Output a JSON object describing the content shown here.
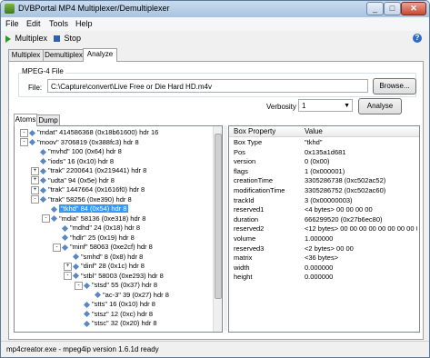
{
  "window": {
    "title": "DVBPortal MP4 Multiplexer/Demultiplexer"
  },
  "menu": [
    "File",
    "Edit",
    "Tools",
    "Help"
  ],
  "toolbar": {
    "multiplex": "Multiplex",
    "stop": "Stop",
    "help_icon": "help-icon"
  },
  "tabs": [
    "Multiplex",
    "Demultiplex",
    "Analyze"
  ],
  "file_group": {
    "title": "MPEG-4 File",
    "file_label": "File:",
    "path": "C:\\Capture\\convert\\Live Free or Die Hard HD.m4v",
    "browse": "Browse..."
  },
  "verbosity": {
    "label": "Verbosity",
    "value": "1",
    "analyse": "Analyse"
  },
  "subtabs": [
    "Atoms",
    "Dump"
  ],
  "tree": [
    {
      "text": "\"mdat\" 414586368 (0x18b61600) hdr 16",
      "expander": "-",
      "indent": 0
    },
    {
      "text": "\"moov\" 3706819 (0x388fc3) hdr 8",
      "expander": "-",
      "indent": 0
    },
    {
      "text": "\"mvhd\" 100 (0x64) hdr 8",
      "expander": "",
      "indent": 1
    },
    {
      "text": "\"iods\" 16 (0x10) hdr 8",
      "expander": "",
      "indent": 1
    },
    {
      "text": "\"trak\" 2200641 (0x219441) hdr 8",
      "expander": "+",
      "indent": 1
    },
    {
      "text": "\"udta\" 94 (0x5e) hdr 8",
      "expander": "+",
      "indent": 1
    },
    {
      "text": "\"trak\" 1447664 (0x1616f0) hdr 8",
      "expander": "+",
      "indent": 1
    },
    {
      "text": "\"trak\" 58256 (0xe390) hdr 8",
      "expander": "-",
      "indent": 1
    },
    {
      "text": "\"tkhd\" 84 (0x54) hdr 8",
      "expander": "",
      "indent": 2,
      "selected": true
    },
    {
      "text": "\"mdia\" 58136 (0xe318) hdr 8",
      "expander": "-",
      "indent": 2
    },
    {
      "text": "\"mdhd\" 24 (0x18) hdr 8",
      "expander": "",
      "indent": 3
    },
    {
      "text": "\"hdlr\" 25 (0x19) hdr 8",
      "expander": "",
      "indent": 3
    },
    {
      "text": "\"minf\" 58063 (0xe2cf) hdr 8",
      "expander": "-",
      "indent": 3
    },
    {
      "text": "\"smhd\" 8 (0x8) hdr 8",
      "expander": "",
      "indent": 4
    },
    {
      "text": "\"dinf\" 28 (0x1c) hdr 8",
      "expander": "+",
      "indent": 4
    },
    {
      "text": "\"stbl\" 58003 (0xe293) hdr 8",
      "expander": "-",
      "indent": 4
    },
    {
      "text": "\"stsd\" 55 (0x37) hdr 8",
      "expander": "-",
      "indent": 5
    },
    {
      "text": "\"ac-3\" 39 (0x27) hdr 8",
      "expander": "",
      "indent": 6
    },
    {
      "text": "\"stts\" 16 (0x10) hdr 8",
      "expander": "",
      "indent": 5
    },
    {
      "text": "\"stsz\" 12 (0xc) hdr 8",
      "expander": "",
      "indent": 5
    },
    {
      "text": "\"stsc\" 32 (0x20) hdr 8",
      "expander": "",
      "indent": 5
    }
  ],
  "props": {
    "header_property": "Box Property",
    "header_value": "Value",
    "rows": [
      {
        "p": "Box Type",
        "v": "\"tkhd\""
      },
      {
        "p": "Pos",
        "v": "0x135a1d681"
      },
      {
        "p": "version",
        "v": "0 (0x00)"
      },
      {
        "p": "flags",
        "v": "1 (0x000001)"
      },
      {
        "p": "creationTime",
        "v": "3305286738 (0xc502ac52)"
      },
      {
        "p": "modificationTime",
        "v": "3305286752 (0xc502ac60)"
      },
      {
        "p": "trackId",
        "v": "3 (0x00000003)"
      },
      {
        "p": "reserved1",
        "v": "<4 bytes> 00 00 00 00"
      },
      {
        "p": "duration",
        "v": "666299520 (0x27b6ec80)"
      },
      {
        "p": "reserved2",
        "v": "<12 bytes> 00 00 00 00 00 00 00 00 00"
      },
      {
        "p": "volume",
        "v": "1.000000"
      },
      {
        "p": "reserved3",
        "v": "<2 bytes> 00 00"
      },
      {
        "p": "matrix",
        "v": "<36 bytes>"
      },
      {
        "p": "width",
        "v": "0.000000"
      },
      {
        "p": "height",
        "v": "0.000000"
      }
    ]
  },
  "status": "mp4creator.exe - mpeg4ip version 1.6.1d ready"
}
